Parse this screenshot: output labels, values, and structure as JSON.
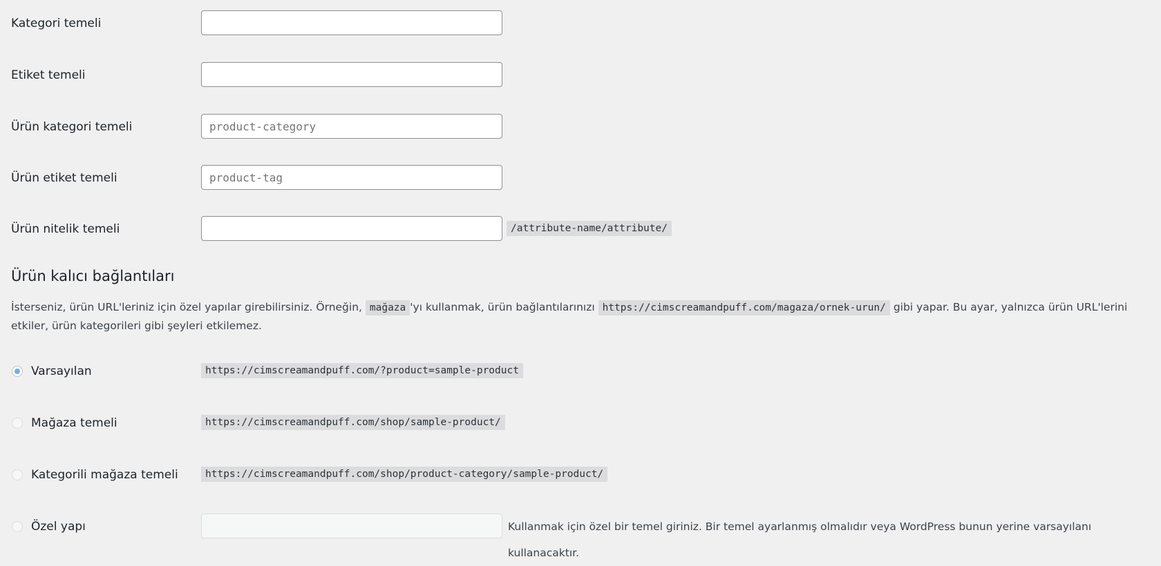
{
  "fields": [
    {
      "label": "Kategori temeli",
      "value": "",
      "placeholder": ""
    },
    {
      "label": "Etiket temeli",
      "value": "",
      "placeholder": ""
    },
    {
      "label": "Ürün kategori temeli",
      "value": "",
      "placeholder": "product-category"
    },
    {
      "label": "Ürün etiket temeli",
      "value": "",
      "placeholder": "product-tag"
    },
    {
      "label": "Ürün nitelik temeli",
      "value": "",
      "placeholder": "",
      "suffix": "/attribute-name/attribute/"
    }
  ],
  "section": {
    "title": "Ürün kalıcı bağlantıları",
    "desc_part1": "İsterseniz, ürün URL'leriniz için özel yapılar girebilirsiniz. Örneğin, ",
    "desc_code1": "mağaza",
    "desc_part2": "'yı kullanmak, ürün bağlantılarınızı ",
    "desc_code2": "https://cimscreamandpuff.com/magaza/ornek-urun/",
    "desc_part3": " gibi yapar. Bu ayar, yalnızca ürün URL'lerini etkiler, ürün kategorileri gibi şeyleri etkilemez."
  },
  "options": [
    {
      "label": "Varsayılan",
      "example": "https://cimscreamandpuff.com/?product=sample-product",
      "checked": true
    },
    {
      "label": "Mağaza temeli",
      "example": "https://cimscreamandpuff.com/shop/sample-product/",
      "checked": false
    },
    {
      "label": "Kategorili mağaza temeli",
      "example": "https://cimscreamandpuff.com/shop/product-category/sample-product/",
      "checked": false
    },
    {
      "label": "Özel yapı",
      "input_value": "",
      "help": "Kullanmak için özel bir temel giriniz. Bir temel ayarlanmış olmalıdır veya WordPress bunun yerine varsayılanı kullanacaktır.",
      "checked": false
    }
  ]
}
